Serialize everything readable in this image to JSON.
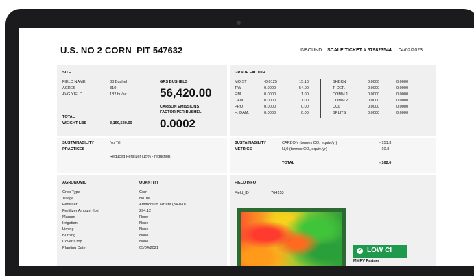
{
  "header": {
    "title": "U.S. NO 2 CORN",
    "pit": "PIT 547632",
    "inbound": "INBOUND",
    "scale_ticket": "SCALE TICKET # 579823544",
    "date": "04/02/2023"
  },
  "site": {
    "heading": "SITE",
    "rows": [
      {
        "label": "FIELD NAME",
        "value": "33 Bushel"
      },
      {
        "label": "ACRES",
        "value": "310"
      },
      {
        "label": "AVG YIELD",
        "value": "182 bu/ac"
      }
    ],
    "total_label_1": "TOTAL",
    "total_label_2": "WEIGHT LBS",
    "total_value": "3,159,520.00",
    "grs_label": "GRS BUSHELS",
    "grs_value": "56,420.00",
    "cef_label_1": "CARBON EMISSIONS",
    "cef_label_2": "FACTOR PER BUSHEL",
    "cef_value": "0.0002"
  },
  "grade_factor": {
    "heading": "GRADE FACTOR",
    "left_rows": [
      {
        "label": "MOIST",
        "a": "-0.0125",
        "b": "15.10"
      },
      {
        "label": "T.W",
        "a": "0.0000",
        "b": "54.00"
      },
      {
        "label": "F.M",
        "a": "0.0000",
        "b": "1.00"
      },
      {
        "label": "DAM.",
        "a": "0.0000",
        "b": "1.00"
      },
      {
        "label": "PRO",
        "a": "0.0000",
        "b": "0.00"
      },
      {
        "label": "H. DAM.",
        "a": "0.0000",
        "b": "0.00"
      }
    ],
    "right_rows": [
      {
        "label": "SHBKN",
        "a": "0.0000",
        "b": "0.0000"
      },
      {
        "label": "T. DEF.",
        "a": "0.0000",
        "b": "0.0000"
      },
      {
        "label": "COMM 1",
        "a": "0.0000",
        "b": "0.0000"
      },
      {
        "label": "COMM 2",
        "a": "0.0000",
        "b": "0.0000"
      },
      {
        "label": "CCL",
        "a": "0.0000",
        "b": "0.0000"
      },
      {
        "label": "SPLITS",
        "a": "0.0000",
        "b": "0.0000"
      }
    ]
  },
  "practices": {
    "heading_1": "SUSTAINABILITY",
    "heading_2": "PRACTICES",
    "item_1": "No Till",
    "item_2": "Reduced Fertilizer (15% - reduction)"
  },
  "metrics": {
    "heading_1": "SUSTAINABILITY",
    "heading_2": "METRICS",
    "carbon_pre": "CARBON (tonnes CO",
    "carbon_sub": "2",
    "carbon_post": " equiv./yr)",
    "carbon_value": "- 151.3",
    "n2o_pre": "N",
    "n2o_sub": "2",
    "n2o_post": "0 (tonnes CO",
    "n2o_sub2": "2",
    "n2o_post2": " equiv./yr)",
    "n2o_value": "- 10.8",
    "total_label": "TOTAL",
    "total_value": "- 162.0"
  },
  "agronomic": {
    "heading": "AGRONOMIC",
    "qty_heading": "QUANTITY",
    "rows": [
      {
        "label": "Crop Type",
        "value": "Corn"
      },
      {
        "label": "Tillage",
        "value": "No Till"
      },
      {
        "label": "Fertilizer",
        "value": "Ammonium Nitrate (34-0-0)"
      },
      {
        "label": "Fertilizer Amount (lbs)",
        "value": "294.12"
      },
      {
        "label": "Manure",
        "value": "None"
      },
      {
        "label": "Irrigation",
        "value": "None"
      },
      {
        "label": "Liming",
        "value": "None"
      },
      {
        "label": "Burning",
        "value": "None"
      },
      {
        "label": "Cover Crop",
        "value": "None"
      },
      {
        "label": "Planting Date",
        "value": "05/04/2021"
      }
    ]
  },
  "field_info": {
    "heading": "FIELD INFO",
    "id_label": "Field_ID",
    "id_value": "764153",
    "badge": "LOW CI",
    "partner": "MMRV Partner"
  }
}
